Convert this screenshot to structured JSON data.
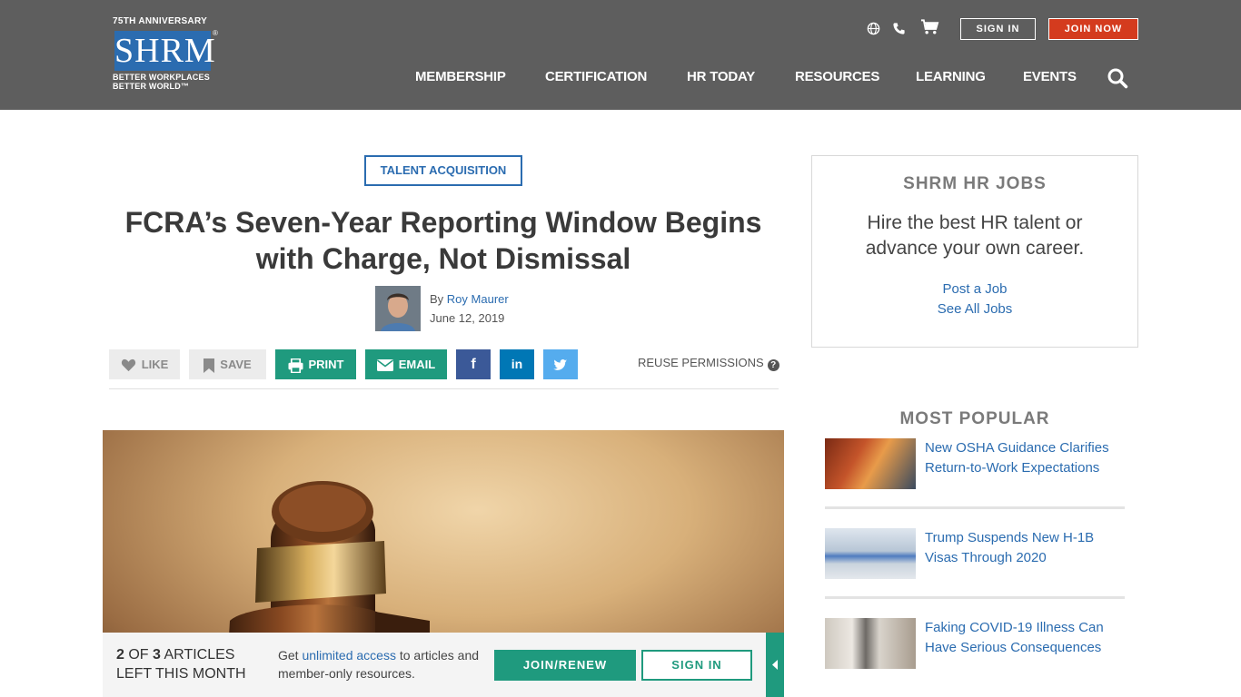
{
  "header": {
    "logo": {
      "anniversary": "75TH ANNIVERSARY",
      "wordmark": "SHRM",
      "tagline_1": "BETTER WORKPLACES",
      "tagline_2": "BETTER WORLD™"
    },
    "utility_icons": [
      "globe-icon",
      "phone-icon",
      "cart-icon"
    ],
    "sign_in_label": "SIGN IN",
    "join_label": "JOIN NOW",
    "nav": [
      "MEMBERSHIP",
      "CERTIFICATION",
      "HR TODAY",
      "RESOURCES",
      "LEARNING",
      "EVENTS"
    ]
  },
  "article": {
    "category": "TALENT ACQUISITION",
    "title": "FCRA’s Seven-Year Reporting Window Begins with Charge, Not Dismissal",
    "by_prefix": "By",
    "author": "Roy Maurer",
    "date": "June 12, 2019",
    "share": {
      "like": "LIKE",
      "save": "SAVE",
      "print": "PRINT",
      "email": "EMAIL",
      "reuse": "REUSE PERMISSIONS",
      "help": "?"
    }
  },
  "paywall": {
    "current": "2",
    "of": "OF",
    "total": "3",
    "articles": "ARTICLES",
    "left": "LEFT THIS MONTH",
    "msg_pre": "Get",
    "msg_link": "unlimited access",
    "msg_post": "to articles and member-only resources.",
    "join_label": "JOIN/RENEW",
    "signin_label": "SIGN IN"
  },
  "sidebar": {
    "jobs_title": "SHRM HR JOBS",
    "jobs_sub": "Hire the best HR talent or advance your own career.",
    "post_job": "Post a Job",
    "see_all": "See All Jobs",
    "popular_title": "MOST POPULAR",
    "popular": [
      {
        "title": "New OSHA Guidance Clarifies Return-to-Work Expectations"
      },
      {
        "title": "Trump Suspends New H-1B Visas Through 2020"
      },
      {
        "title": "Faking COVID-19 Illness Can Have Serious Consequences"
      }
    ]
  },
  "colors": {
    "header_bg": "#5e5e5e",
    "brand_blue": "#2b6cb0",
    "join_red": "#d43b1e",
    "action_green": "#1f9a7e",
    "facebook": "#3b5998",
    "linkedin": "#0077b5",
    "twitter": "#55acee"
  }
}
